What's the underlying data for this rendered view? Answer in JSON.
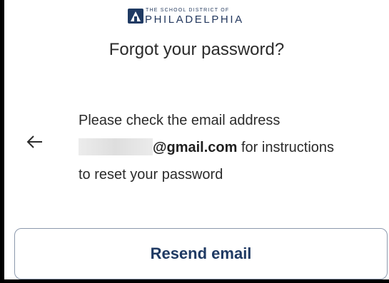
{
  "logo": {
    "small_text": "THE SCHOOL DISTRICT OF",
    "big_text": "PHILADELPHIA",
    "icon": "district-logo-icon"
  },
  "page": {
    "title": "Forgot your password?"
  },
  "back": {
    "icon": "arrow-left-icon"
  },
  "message": {
    "line1": "Please check the email address",
    "email_domain": "@gmail.com",
    "line2_suffix": " for instructions",
    "line3": "to reset your password"
  },
  "actions": {
    "resend_label": "Resend email"
  },
  "colors": {
    "brand_navy": "#1f3a63",
    "button_border": "#8c99ad",
    "text": "#2b2b2b"
  }
}
